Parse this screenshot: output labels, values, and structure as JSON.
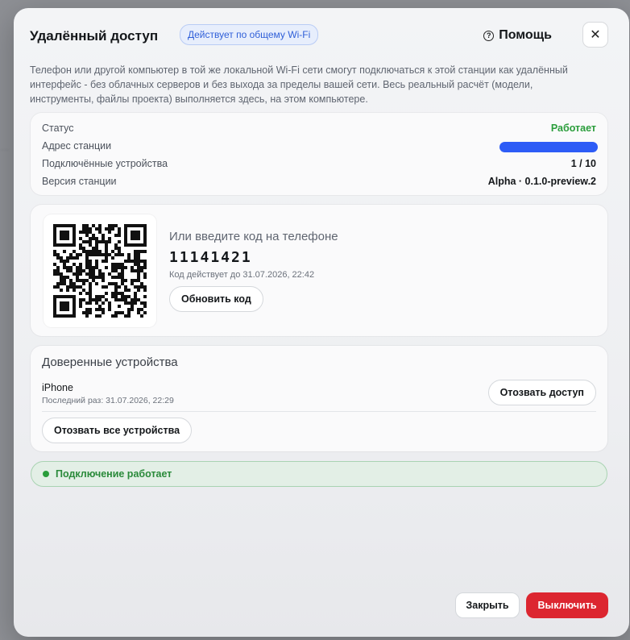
{
  "header": {
    "title": "Удалённый доступ",
    "badge": "Действует по общему Wi-Fi",
    "help_label": "Помощь",
    "help_icon": "?",
    "close_icon": "✕"
  },
  "description": "Телефон или другой компьютер в той же локальной Wi-Fi сети смогут подключаться к этой станции как удалённый интерфейс - без облачных серверов и без выхода за пределы вашей сети. Весь реальный расчёт (модели, инструменты, файлы проекта) выполняется здесь, на этом компьютере.",
  "status": {
    "rows": [
      {
        "label": "Статус",
        "value": "Работает"
      },
      {
        "label": "Адрес станции",
        "value": ""
      },
      {
        "label": "Подключённые устройства",
        "value": "1 / 10"
      },
      {
        "label": "Версия станции",
        "value": "Alpha · 0.1.0-preview.2"
      }
    ],
    "ok_color": "#2a9d3b",
    "redaction_color": "#2d5cf6"
  },
  "pairing": {
    "code_prompt": "Или введите код на телефоне",
    "code": "11141421",
    "expires": "Код действует до 31.07.2026, 22:42",
    "refresh_label": "Обновить код"
  },
  "trusted": {
    "title": "Доверенные устройства",
    "devices": [
      {
        "name": "iPhone",
        "last_seen": "Последний раз: 31.07.2026, 22:29",
        "revoke_label": "Отозвать доступ"
      }
    ],
    "revoke_all_label": "Отозвать все устройства"
  },
  "connection": {
    "label": "Подключение работает",
    "color": "#2a9d3b"
  },
  "footer": {
    "close_label": "Закрыть",
    "disable_label": "Выключить",
    "disable_color": "#dc2630"
  }
}
